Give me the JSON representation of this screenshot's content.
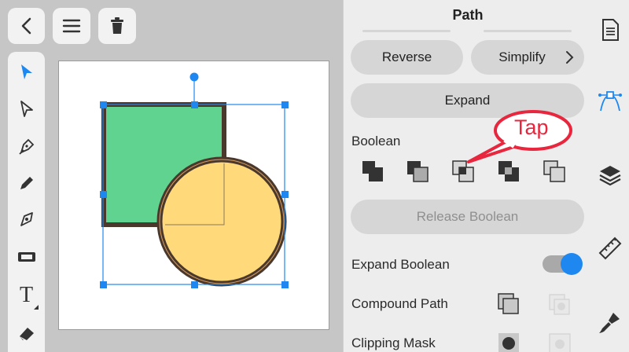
{
  "top_buttons": {
    "back_icon": "chevron-left-icon",
    "menu_icon": "hamburger-icon",
    "delete_icon": "trash-icon"
  },
  "tools": [
    "select-arrow-icon",
    "direct-select-icon",
    "pen-icon",
    "pencil-icon",
    "node-tool-icon",
    "fill-tool-icon",
    "text-tool-icon",
    "eraser-icon"
  ],
  "text_tool_glyph": "T",
  "panel": {
    "title": "Path",
    "reverse_label": "Reverse",
    "simplify_label": "Simplify",
    "expand_label": "Expand",
    "boolean_label": "Boolean",
    "release_boolean_label": "Release Boolean",
    "expand_boolean_label": "Expand Boolean",
    "expand_boolean_on": true,
    "compound_path_label": "Compound Path",
    "clipping_mask_label": "Clipping Mask"
  },
  "annotation": {
    "text": "Tap",
    "color": "#e8263d"
  },
  "colors": {
    "accent": "#1e88f0",
    "square_fill": "#5fd38f",
    "circle_fill": "#ffd97a",
    "stroke": "#4a382c"
  },
  "right_bar_icons": [
    "document-icon",
    "path-tool-icon",
    "layers-icon",
    "ruler-icon",
    "brush-icon"
  ]
}
